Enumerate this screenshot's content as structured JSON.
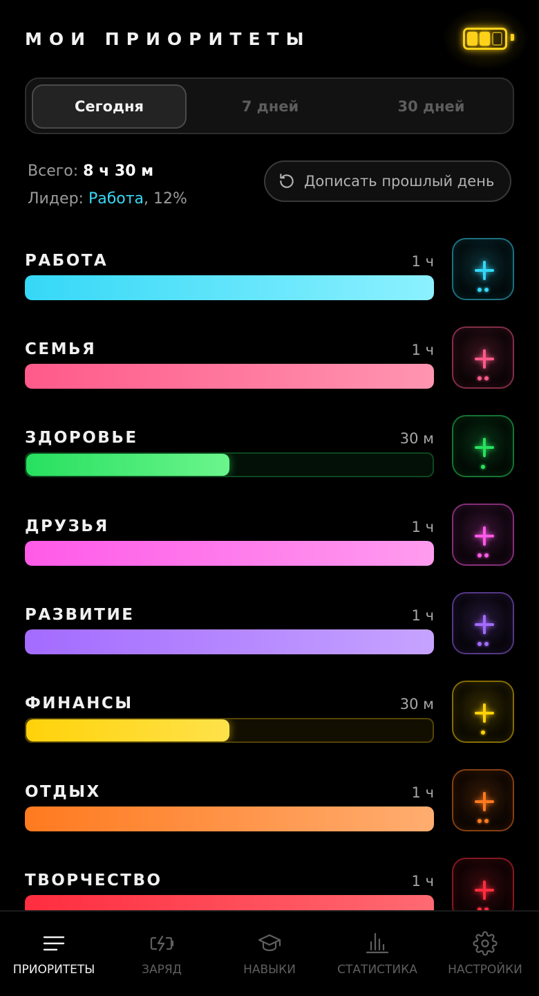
{
  "header": {
    "title": "МОИ ПРИОРИТЕТЫ"
  },
  "battery": {
    "icon": "battery-icon",
    "filled_cells": 2,
    "total_cells": 3,
    "color": "#ffd21a"
  },
  "period_tabs": [
    {
      "label": "Сегодня",
      "active": true
    },
    {
      "label": "7 дней",
      "active": false
    },
    {
      "label": "30 дней",
      "active": false
    }
  ],
  "summary": {
    "total_label": "Всего:",
    "total_value": "8 ч 30 м",
    "leader_label": "Лидер:",
    "leader_name": "Работа",
    "leader_percent": ", 12%"
  },
  "backfill_button": {
    "label": "Дописать прошлый день",
    "icon": "history-icon"
  },
  "priorities": [
    {
      "name": "РАБОТА",
      "time": "1 ч",
      "progress": 1.0,
      "color": "#35d8f7",
      "color_end": "#8cf1ff",
      "dots": 2
    },
    {
      "name": "СЕМЬЯ",
      "time": "1 ч",
      "progress": 1.0,
      "color": "#ff5a8a",
      "color_end": "#ff95b0",
      "dots": 2
    },
    {
      "name": "ЗДОРОВЬЕ",
      "time": "30 м",
      "progress": 0.5,
      "color": "#27e05f",
      "color_end": "#6bf58c",
      "dots": 1
    },
    {
      "name": "ДРУЗЬЯ",
      "time": "1 ч",
      "progress": 1.0,
      "color": "#ff5ae8",
      "color_end": "#ff9cef",
      "dots": 2
    },
    {
      "name": "РАЗВИТИЕ",
      "time": "1 ч",
      "progress": 1.0,
      "color": "#a36bff",
      "color_end": "#c6a3ff",
      "dots": 2
    },
    {
      "name": "ФИНАНСЫ",
      "time": "30 м",
      "progress": 0.5,
      "color": "#ffd20a",
      "color_end": "#ffe24a",
      "dots": 1
    },
    {
      "name": "ОТДЫХ",
      "time": "1 ч",
      "progress": 1.0,
      "color": "#ff7a1f",
      "color_end": "#ffad70",
      "dots": 2
    },
    {
      "name": "ТВОРЧЕСТВО",
      "time": "1 ч",
      "progress": 1.0,
      "color": "#ff2d3f",
      "color_end": "#ff6a72",
      "dots": 2
    }
  ],
  "tabbar": [
    {
      "label": "ПРИОРИТЕТЫ",
      "icon": "menu-lines-icon",
      "active": true
    },
    {
      "label": "ЗАРЯД",
      "icon": "battery-charge-icon",
      "active": false
    },
    {
      "label": "НАВЫКИ",
      "icon": "graduation-cap-icon",
      "active": false
    },
    {
      "label": "СТАТИСТИКА",
      "icon": "bar-chart-icon",
      "active": false
    },
    {
      "label": "НАСТРОЙКИ",
      "icon": "gear-icon",
      "active": false
    }
  ]
}
